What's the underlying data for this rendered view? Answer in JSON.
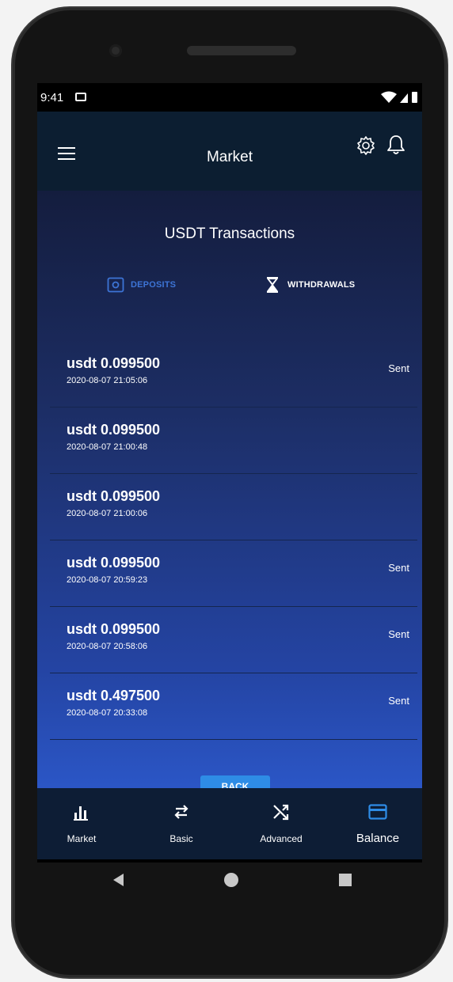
{
  "status_bar": {
    "time": "9:41",
    "image_icon": "image-icon",
    "wifi_icon": "wifi-icon",
    "signal_icon": "signal-icon",
    "battery_icon": "battery-icon"
  },
  "app_bar": {
    "title": "Market",
    "menu_icon": "hamburger-menu-icon",
    "settings_icon": "gear-icon",
    "notifications_icon": "bell-icon"
  },
  "page": {
    "heading": "USDT Transactions",
    "tabs": [
      {
        "label": "DEPOSITS",
        "icon": "deposit-box-icon",
        "active": false,
        "color": "#3d74d6"
      },
      {
        "label": "WITHDRAWALS",
        "icon": "hourglass-icon",
        "active": true,
        "color": "#ffffff"
      }
    ]
  },
  "transactions": [
    {
      "amount": "usdt 0.099500",
      "date": "2020-08-07 21:05:06",
      "status": "Sent"
    },
    {
      "amount": "usdt 0.099500",
      "date": "2020-08-07 21:00:48",
      "status": ""
    },
    {
      "amount": "usdt 0.099500",
      "date": "2020-08-07 21:00:06",
      "status": ""
    },
    {
      "amount": "usdt 0.099500",
      "date": "2020-08-07 20:59:23",
      "status": "Sent"
    },
    {
      "amount": "usdt 0.099500",
      "date": "2020-08-07 20:58:06",
      "status": "Sent"
    },
    {
      "amount": "usdt 0.497500",
      "date": "2020-08-07 20:33:08",
      "status": "Sent"
    }
  ],
  "back_button": {
    "label": "BACK"
  },
  "bottom_nav": {
    "items": [
      {
        "label": "Market",
        "icon": "bar-chart-icon",
        "active": false
      },
      {
        "label": "Basic",
        "icon": "swap-arrows-icon",
        "active": false
      },
      {
        "label": "Advanced",
        "icon": "shuffle-icon",
        "active": false
      },
      {
        "label": "Balance",
        "icon": "credit-card-icon",
        "active": true
      }
    ]
  },
  "system_nav": {
    "back_icon": "back-triangle-icon",
    "home_icon": "home-circle-icon",
    "recents_icon": "recents-square-icon"
  },
  "colors": {
    "app_bar_bg": "#0c1e31",
    "content_gradient_top": "#141d3e",
    "content_gradient_bottom": "#2b56c6",
    "accent_blue": "#2e8ce6",
    "nav_bg": "#0d1d35",
    "balance_active": "#2e8ce6"
  }
}
